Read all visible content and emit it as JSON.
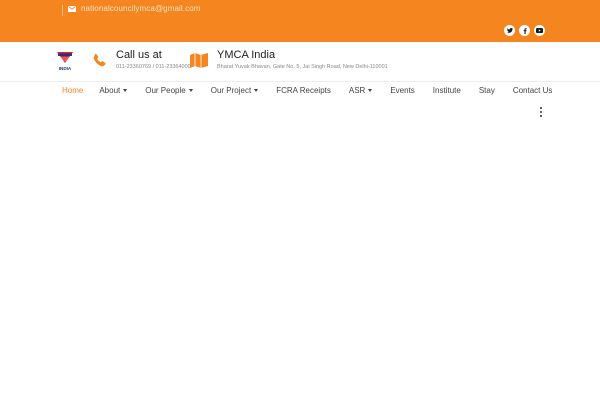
{
  "topbar": {
    "email": "nationalcouncilymca@gmail.com",
    "socials": [
      "twitter-icon",
      "facebook-icon",
      "youtube-icon"
    ],
    "accent_color": "#f5851f"
  },
  "header": {
    "logo_text": "INDIA",
    "call": {
      "label": "Call us at",
      "numbers": "011-23360769 / 011-23364000"
    },
    "location": {
      "label": "YMCA India",
      "address": "Bharat Yuvak Bhavan, Gate No. 5, Jai Singh Road, New Delhi-110001"
    }
  },
  "nav": {
    "items": [
      {
        "label": "Home",
        "dropdown": false,
        "active": true
      },
      {
        "label": "About",
        "dropdown": true,
        "active": false
      },
      {
        "label": "Our People",
        "dropdown": true,
        "active": false
      },
      {
        "label": "Our Project",
        "dropdown": true,
        "active": false
      },
      {
        "label": "FCRA Receipts",
        "dropdown": false,
        "active": false
      },
      {
        "label": "ASR",
        "dropdown": true,
        "active": false
      },
      {
        "label": "Events",
        "dropdown": false,
        "active": false
      },
      {
        "label": "Institute",
        "dropdown": false,
        "active": false
      },
      {
        "label": "Stay",
        "dropdown": false,
        "active": false
      },
      {
        "label": "Contact Us",
        "dropdown": false,
        "active": false
      }
    ]
  }
}
